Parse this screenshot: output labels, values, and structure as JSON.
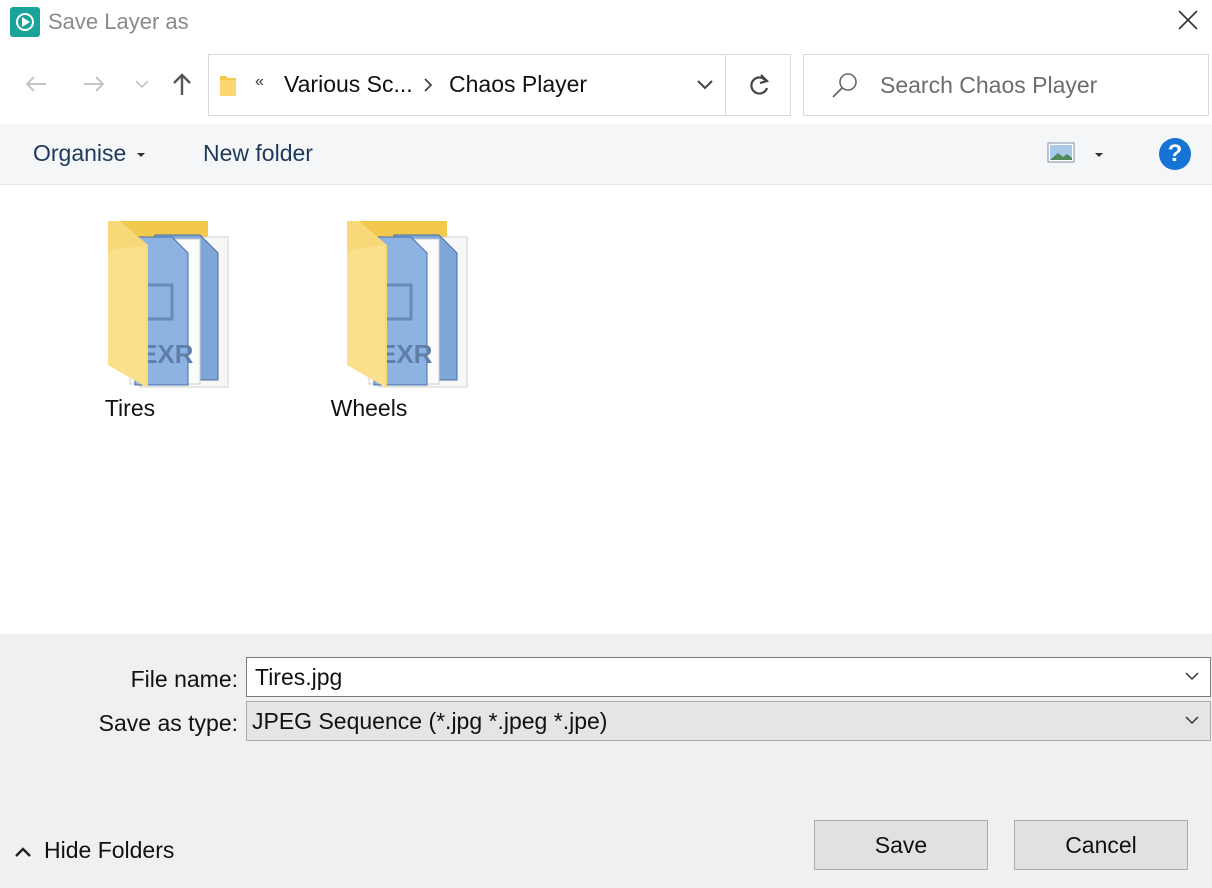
{
  "window": {
    "title": "Save Layer as"
  },
  "nav": {
    "breadcrumb_overflow": "«",
    "breadcrumbs": [
      "Various Sc...",
      "Chaos Player"
    ],
    "search_placeholder": "Search Chaos Player"
  },
  "toolbar": {
    "organise_label": "Organise",
    "new_folder_label": "New folder",
    "help_label": "?"
  },
  "items": [
    {
      "name": "Tires",
      "icon": "folder-exr-icon"
    },
    {
      "name": "Wheels",
      "icon": "folder-exr-icon"
    }
  ],
  "form": {
    "file_name_label": "File name:",
    "file_name_value": "Tires.jpg",
    "save_as_type_label": "Save as type:",
    "save_as_type_value": "JPEG Sequence (*.jpg *.jpeg *.jpe)"
  },
  "footer": {
    "hide_folders_label": "Hide Folders",
    "save_label": "Save",
    "cancel_label": "Cancel"
  },
  "colors": {
    "app_icon": "#1aa39b",
    "help_icon": "#1673d6",
    "command_text": "#1e395b"
  }
}
